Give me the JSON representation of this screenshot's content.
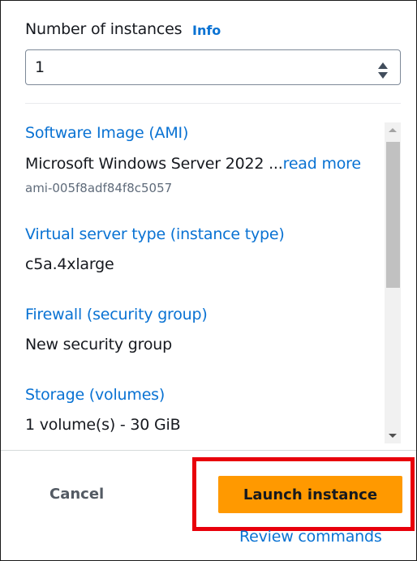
{
  "instances": {
    "label": "Number of instances",
    "info_link": "Info",
    "value": "1"
  },
  "summary": {
    "ami": {
      "title": "Software Image (AMI)",
      "value": "Microsoft Windows Server 2022 ...",
      "read_more": "read more",
      "id": "ami-005f8adf84f8c5057"
    },
    "instance_type": {
      "title": "Virtual server type (instance type)",
      "value": "c5a.4xlarge"
    },
    "firewall": {
      "title": "Firewall (security group)",
      "value": "New security group"
    },
    "storage": {
      "title": "Storage (volumes)",
      "value": "1 volume(s) - 30 GiB"
    }
  },
  "footer": {
    "cancel_label": "Cancel",
    "launch_label": "Launch instance",
    "review_label": "Review commands"
  },
  "colors": {
    "link": "#0972d3",
    "primary_button": "#ff9900",
    "highlight": "#e8000b",
    "text": "#16191f"
  }
}
